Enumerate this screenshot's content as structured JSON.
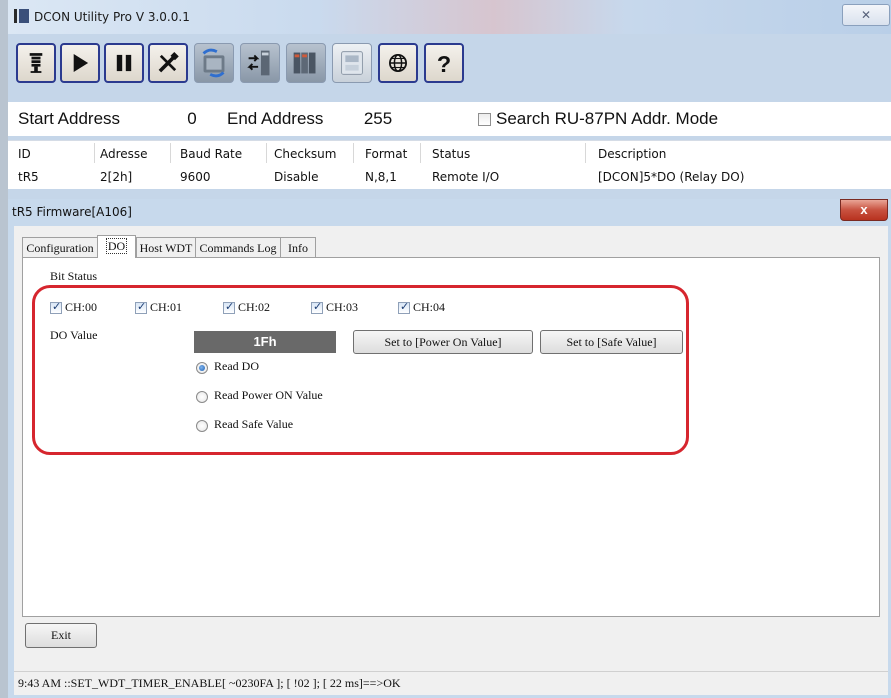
{
  "main_window": {
    "title": "DCON Utility Pro V 3.0.0.1",
    "close_glyph": "✕",
    "toolbar": [
      {
        "name": "search-bus-button",
        "icon": "bus-search-icon"
      },
      {
        "name": "start-search-button",
        "icon": "play-icon"
      },
      {
        "name": "pause-search-button",
        "icon": "pause-icon"
      },
      {
        "name": "tools-button",
        "icon": "tools-icon"
      },
      {
        "name": "module-config-button",
        "icon": "module-arrow-icon"
      },
      {
        "name": "io-module-button",
        "icon": "io-module-icon"
      },
      {
        "name": "device-rack-button",
        "icon": "device-rack-icon"
      },
      {
        "name": "panel-button",
        "icon": "panel-icon"
      },
      {
        "name": "network-button",
        "icon": "globe-icon"
      },
      {
        "name": "help-button",
        "icon": "question-icon"
      }
    ],
    "address_row": {
      "start_label": "Start Address",
      "start_value": "0",
      "end_label": "End Address",
      "end_value": "255",
      "search_mode_label": "Search RU-87PN Addr. Mode"
    },
    "device_table": {
      "columns": [
        "ID",
        "Adresse",
        "Baud Rate",
        "Checksum",
        "Format",
        "Status",
        "Description"
      ],
      "rows": [
        [
          "tR5",
          "2[2h]",
          "9600",
          "Disable",
          "N,8,1",
          "Remote I/O",
          "[DCON]5*DO (Relay DO)"
        ]
      ]
    }
  },
  "dialog": {
    "title": "tR5 Firmware[A106]",
    "close_glyph": "x",
    "tabs": [
      "Configuration",
      "DO",
      "Host WDT",
      "Commands Log",
      "Info"
    ],
    "active_tab": "DO",
    "do_page": {
      "bit_status_label": "Bit Status",
      "channels": [
        "CH:00",
        "CH:01",
        "CH:02",
        "CH:03",
        "CH:04"
      ],
      "channel_checked": [
        true,
        true,
        true,
        true,
        true
      ],
      "do_value_label": "DO Value",
      "do_value": "1Fh",
      "set_power_on_button": "Set to [Power On Value]",
      "set_safe_button": "Set to [Safe Value]",
      "read_options": [
        "Read DO",
        "Read Power ON Value",
        "Read Safe Value"
      ],
      "selected_read_option": "Read DO"
    },
    "exit_button": "Exit",
    "status_bar": "9:43 AM ::SET_WDT_TIMER_ENABLE[ ~0230FA ]; [ !02 ]; [ 22 ms]==>OK"
  },
  "colors": {
    "highlight": "#d6262e",
    "window_frame": "#c7d9ec",
    "do_display_bg": "#696969",
    "toolbar_button_border": "#2b3a8f"
  }
}
